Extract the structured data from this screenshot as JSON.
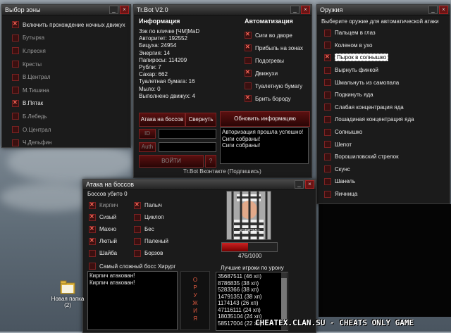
{
  "zones": {
    "title": "Выбор зоны",
    "items": [
      {
        "label": "Включить прохождение ночных движух",
        "checked": true,
        "active": true
      },
      {
        "label": "Бутырка",
        "checked": false,
        "active": false
      },
      {
        "label": "К.пресня",
        "checked": false,
        "active": false
      },
      {
        "label": "Кресты",
        "checked": false,
        "active": false
      },
      {
        "label": "В.Централ",
        "checked": false,
        "active": false
      },
      {
        "label": "М.Тишина",
        "checked": false,
        "active": false
      },
      {
        "label": "В.Пятак",
        "checked": true,
        "active": true
      },
      {
        "label": "Б.Лебедь",
        "checked": false,
        "active": false
      },
      {
        "label": "О.Централ",
        "checked": false,
        "active": false
      },
      {
        "label": "Ч.Дельфин",
        "checked": false,
        "active": false
      }
    ]
  },
  "trbot": {
    "title": "Tr.Bot V2.0",
    "info_header": "Информация",
    "info_lines": [
      "Зэк по кличке [ЧМ]MaD",
      "Авторитет: 192552",
      "Бицуха: 24954",
      "Энергия: 14",
      "Папиросы: 114209",
      "Рубли: 7",
      "Сахар: 662",
      "Туалетная бумага: 16",
      "Мыло: 0",
      "Выполнено движух: 4"
    ],
    "auto_header": "Автоматизация",
    "auto_items": [
      {
        "label": "Сиги во дворе",
        "checked": true
      },
      {
        "label": "Прибыль на зонах",
        "checked": true
      },
      {
        "label": "Подогревы",
        "checked": false
      },
      {
        "label": "Движухи",
        "checked": true
      },
      {
        "label": "Туалетную бумагу",
        "checked": false
      },
      {
        "label": "Брить бороду",
        "checked": true
      }
    ],
    "boss_attack_button": "Атака на боссов",
    "collapse_button": "Свернуть",
    "update_button": "Обновить информацию",
    "id_label": "ID",
    "auth_label": "Auth",
    "login_button": "ВОЙТИ",
    "help_button": "?",
    "log_lines": [
      "Авторизация прошла успешно!",
      "Сиги собраны!",
      "Сиги собраны!"
    ],
    "footer": "Tr.Bot Вконтакте (Подпишись)"
  },
  "weapons": {
    "title": "Оружия",
    "subtitle": "Выберите оружие для автоматической атаки",
    "items": [
      {
        "label": "Пальцем в глаз",
        "checked": false,
        "selected": false
      },
      {
        "label": "Коленом в ухо",
        "checked": false,
        "selected": false
      },
      {
        "label": "Пырок в солнышко",
        "checked": true,
        "selected": true
      },
      {
        "label": "Вырнуть финкой",
        "checked": false,
        "selected": false
      },
      {
        "label": "Шмальнуть из самопала",
        "checked": false,
        "selected": false
      },
      {
        "label": "Подкинуть яда",
        "checked": false,
        "selected": false
      },
      {
        "label": "Слабая концентрация яда",
        "checked": false,
        "selected": false
      },
      {
        "label": "Лошадиная концентрация яда",
        "checked": false,
        "selected": false
      },
      {
        "label": "Солнышко",
        "checked": false,
        "selected": false
      },
      {
        "label": "Шепот",
        "checked": false,
        "selected": false
      },
      {
        "label": "Ворошиловский стрелок",
        "checked": false,
        "selected": false
      },
      {
        "label": "Скунс",
        "checked": false,
        "selected": false
      },
      {
        "label": "Шанель",
        "checked": false,
        "selected": false
      },
      {
        "label": "Яичница",
        "checked": false,
        "selected": false
      }
    ]
  },
  "boss": {
    "title": "Атака на боссов",
    "killed_label": "Боссов убито",
    "killed_count": "0",
    "col1": [
      {
        "label": "Кирпич",
        "checked": true,
        "dim": true
      },
      {
        "label": "Сизый",
        "checked": true,
        "dim": false
      },
      {
        "label": "Махно",
        "checked": true,
        "dim": false
      },
      {
        "label": "Лютый",
        "checked": true,
        "dim": false
      },
      {
        "label": "Шайба",
        "checked": false,
        "dim": false
      }
    ],
    "col2": [
      {
        "label": "Палыч",
        "checked": true,
        "dim": false
      },
      {
        "label": "Циклоп",
        "checked": false,
        "dim": false
      },
      {
        "label": "Бес",
        "checked": false,
        "dim": false
      },
      {
        "label": "Паленый",
        "checked": false,
        "dim": false
      },
      {
        "label": "Борзов",
        "checked": false,
        "dim": false
      }
    ],
    "hardest": {
      "label": "Самый сложный босс Хирург",
      "checked": false
    },
    "boss_name": "КИРПИЧ",
    "hp_text": "476/1000",
    "hp_fraction": 0.476,
    "log_lines": [
      "Кирпич атакован!",
      "Кирпич атакован!"
    ],
    "weapons_vertical": [
      "О",
      "Р",
      "У",
      "Ж",
      "И",
      "Я"
    ],
    "top_title": "Лучшие игроки по урону",
    "top_list": [
      "35687511 (46 хп)",
      "8786835 (38 хп)",
      "5283366 (38 хп)",
      "14791351 (38 хп)",
      "1174143 (26 хп)",
      "47116111 (24 хп)",
      "18035104 (24 хп)",
      "58517004 (22 хп)"
    ]
  },
  "desktop": {
    "folder_label_1": "Новая папка",
    "folder_label_2": "(2)",
    "watermark": "CHEATEX.CLAN.SU - CHEATS ONLY GAME"
  },
  "colors": {
    "accent": "#7a2222",
    "check_mark": "#ff6a5a",
    "panel": "#1b1b1b"
  }
}
